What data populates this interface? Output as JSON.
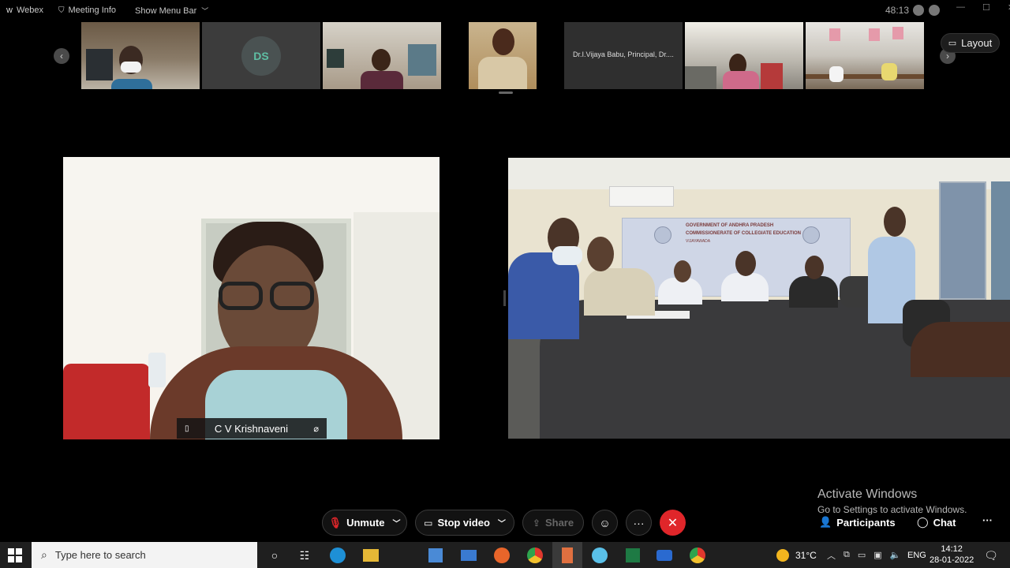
{
  "topbar": {
    "app_name": "Webex",
    "meeting_info": "Meeting Info",
    "show_menu_bar": "Show Menu Bar",
    "timer": "48:13"
  },
  "strip": {
    "thumbnails": [
      {
        "type": "video",
        "bg": "#6f5f49"
      },
      {
        "type": "avatar",
        "initials": "DS"
      },
      {
        "type": "video",
        "bg": "#a89a88"
      },
      {
        "type": "video",
        "bg": "#b49a6a"
      },
      {
        "type": "name",
        "name": "Dr.I.Vijaya Babu, Principal, Dr...."
      },
      {
        "type": "video",
        "bg": "#8a8a84"
      },
      {
        "type": "video",
        "bg": "#9a948c"
      }
    ],
    "layout_label": "Layout"
  },
  "main": {
    "left_participant": "C V Krishnaveni",
    "banner_line1": "GOVERNMENT OF ANDHRA PRADESH",
    "banner_line2": "COMMISSIONERATE OF COLLEGIATE EDUCATION",
    "banner_line3": "VIJAYAWADA"
  },
  "controls": {
    "unmute": "Unmute",
    "stop_video": "Stop video",
    "share": "Share",
    "participants": "Participants",
    "chat": "Chat"
  },
  "watermark": {
    "line1": "Activate Windows",
    "line2": "Go to Settings to activate Windows."
  },
  "taskbar": {
    "search_placeholder": "Type here to search",
    "temperature": "31°C",
    "language": "ENG",
    "time": "14:12",
    "date": "28-01-2022"
  }
}
